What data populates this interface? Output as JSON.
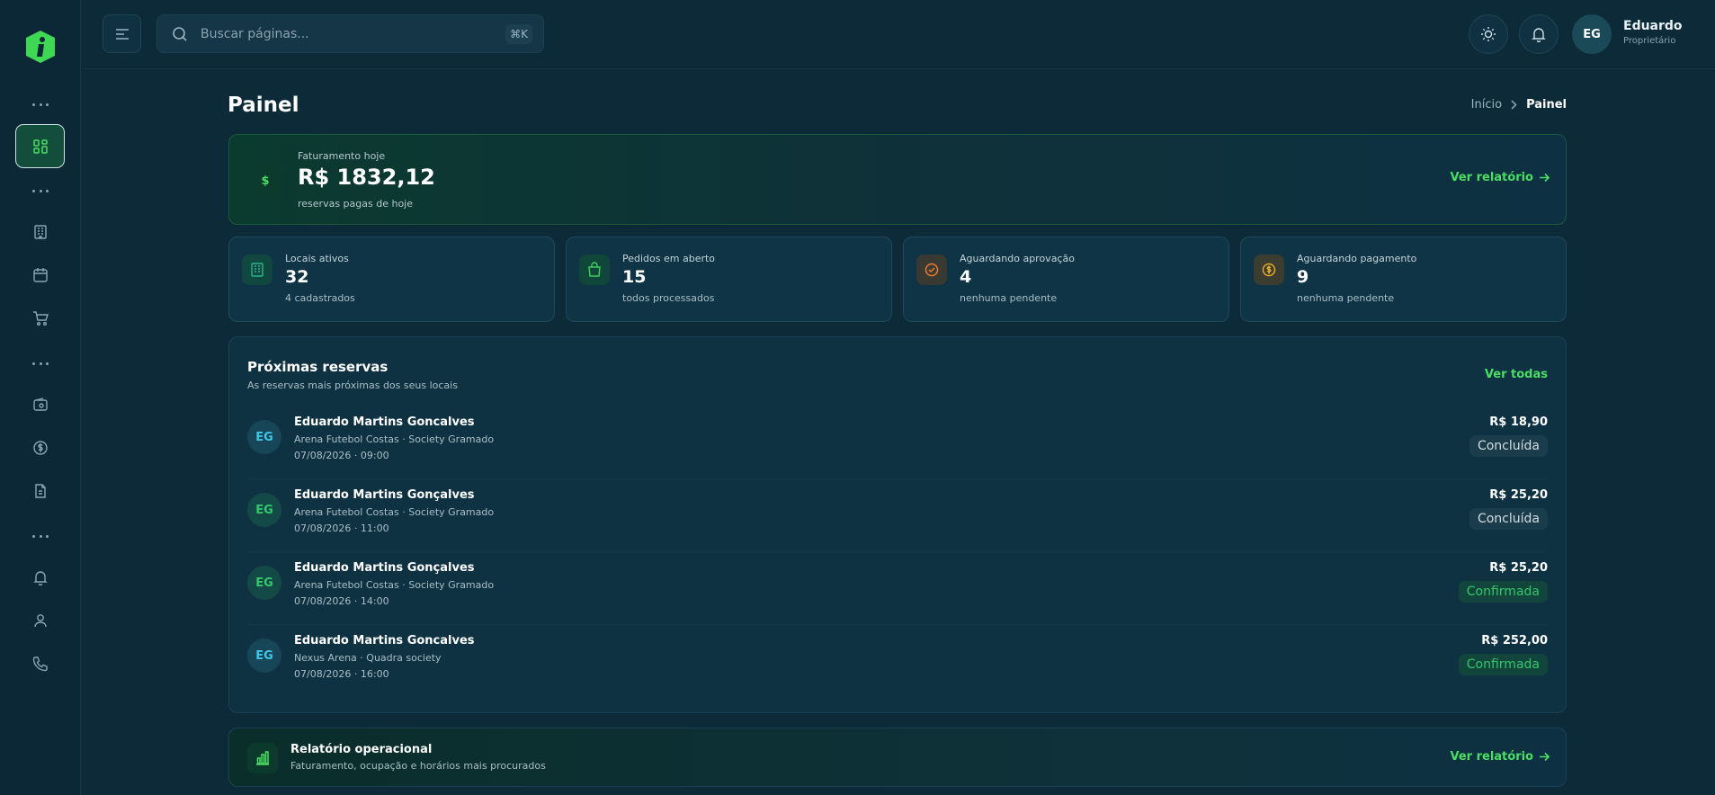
{
  "header": {
    "search_placeholder": "Buscar páginas...",
    "search_shortcut": "⌘K",
    "user": {
      "initials": "EG",
      "name": "Eduardo",
      "role": "Proprietário"
    }
  },
  "page": {
    "title": "Painel",
    "breadcrumb": {
      "home": "Início",
      "current": "Painel"
    }
  },
  "revenue": {
    "label": "Faturamento hoje",
    "value": "R$ 1832,12",
    "sub": "reservas pagas de hoje",
    "link": "Ver relatório"
  },
  "stats": [
    {
      "label": "Locais ativos",
      "value": "32",
      "sub": "4 cadastrados",
      "icon": "building-icon",
      "color": "#2bb58c"
    },
    {
      "label": "Pedidos em aberto",
      "value": "15",
      "sub": "todos processados",
      "icon": "bag-icon",
      "color": "#3fcf5e"
    },
    {
      "label": "Aguardando aprovação",
      "value": "4",
      "sub": "nenhuma pendente",
      "icon": "check-circle-icon",
      "color": "#f07a2a"
    },
    {
      "label": "Aguardando pagamento",
      "value": "9",
      "sub": "nenhuma pendente",
      "icon": "coin-icon",
      "color": "#e6a82a"
    }
  ],
  "reservas": {
    "title": "Próximas reservas",
    "subtitle": "As reservas mais próximas dos seus locais",
    "link": "Ver todas",
    "items": [
      {
        "initials": "EG",
        "name": "Eduardo Martins Goncalves",
        "place": "Arena Futebol Costas · Society Gramado",
        "date": "07/08/2026 · 09:00",
        "price": "R$ 18,90",
        "status": "Concluída"
      },
      {
        "initials": "EG",
        "name": "Eduardo Martins Gonçalves",
        "place": "Arena Futebol Costas · Society Gramado",
        "date": "07/08/2026 · 11:00",
        "price": "R$ 25,20",
        "status": "Concluída"
      },
      {
        "initials": "EG",
        "name": "Eduardo Martins Gonçalves",
        "place": "Arena Futebol Costas · Society Gramado",
        "date": "07/08/2026 · 14:00",
        "price": "R$ 25,20",
        "status": "Confirmada"
      },
      {
        "initials": "EG",
        "name": "Eduardo Martins Goncalves",
        "place": "Nexus Arena · Quadra society",
        "date": "07/08/2026 · 16:00",
        "price": "R$ 252,00",
        "status": "Confirmada"
      }
    ]
  },
  "report": {
    "title": "Relatório operacional",
    "sub": "Faturamento, ocupação e horários mais procurados",
    "link": "Ver relatório"
  },
  "colors": {
    "accent": "#4ade64",
    "background": "#0d2a39",
    "status_done": "#d2dde1",
    "status_confirmed": "#34c76a"
  }
}
